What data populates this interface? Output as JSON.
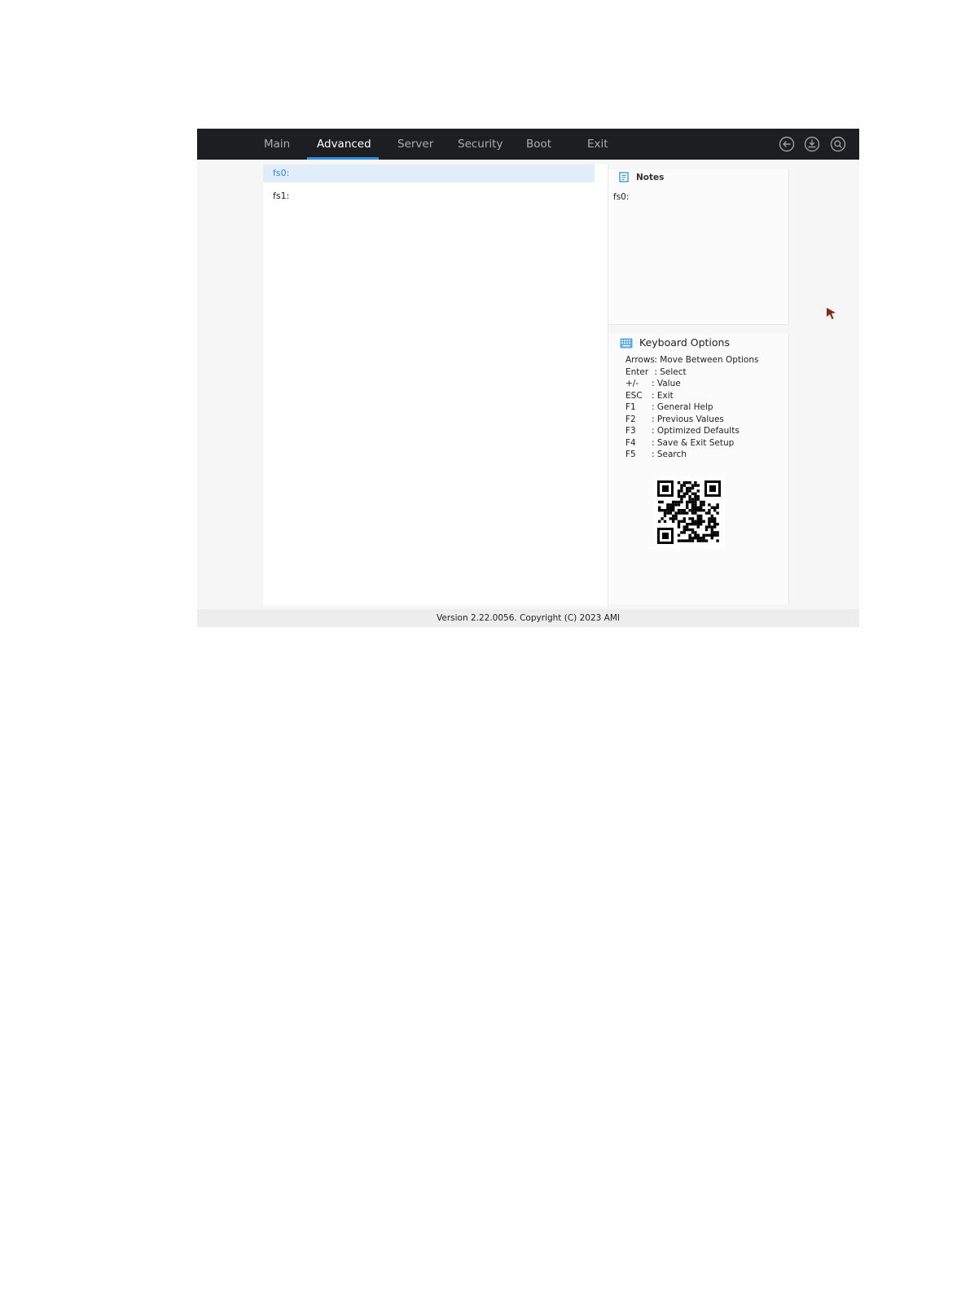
{
  "nav": {
    "tabs": [
      {
        "label": "Main",
        "active": false
      },
      {
        "label": "Advanced",
        "active": true
      },
      {
        "label": "Server",
        "active": false
      },
      {
        "label": "Security",
        "active": false
      },
      {
        "label": "Boot",
        "active": false
      },
      {
        "label": "Exit",
        "active": false
      }
    ],
    "icons": [
      "back-icon",
      "save-icon",
      "search-icon"
    ]
  },
  "main": {
    "items": [
      {
        "label": "fs0:",
        "selected": true
      },
      {
        "label": "fs1:",
        "selected": false
      }
    ]
  },
  "notes": {
    "title": "Notes",
    "body": "fs0:"
  },
  "keyboard": {
    "title": "Keyboard Options",
    "options": [
      {
        "key": "Arrows",
        "desc": ": Move Between Options"
      },
      {
        "key": "Enter",
        "desc": ": Select"
      },
      {
        "key": "+/-",
        "desc": ": Value"
      },
      {
        "key": "ESC",
        "desc": ": Exit"
      },
      {
        "key": "F1",
        "desc": ": General Help"
      },
      {
        "key": "F2",
        "desc": ": Previous Values"
      },
      {
        "key": "F3",
        "desc": ": Optimized Defaults"
      },
      {
        "key": "F4",
        "desc": ": Save & Exit Setup"
      },
      {
        "key": "F5",
        "desc": ": Search"
      }
    ]
  },
  "footer": {
    "text": "Version 2.22.0056. Copyright (C) 2023 AMI"
  },
  "colors": {
    "topbar": "#1c1e22",
    "accent": "#2f8fdc",
    "selection_bg": "#e1edf9",
    "selection_text": "#3b82d4",
    "cursor": "#8b2a12"
  }
}
